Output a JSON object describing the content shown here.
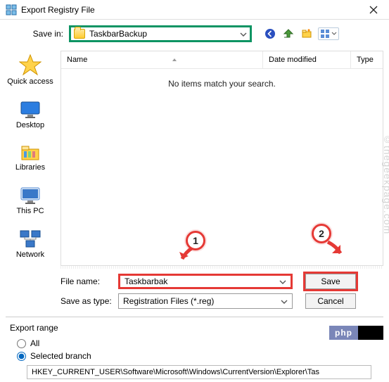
{
  "title": "Export Registry File",
  "savein": {
    "label": "Save in:",
    "value": "TaskbarBackup"
  },
  "places": {
    "quick_access": "Quick access",
    "desktop": "Desktop",
    "libraries": "Libraries",
    "this_pc": "This PC",
    "network": "Network"
  },
  "columns": {
    "name": "Name",
    "date": "Date modified",
    "type": "Type"
  },
  "empty_message": "No items match your search.",
  "filename": {
    "label": "File name:",
    "value": "Taskbarbak"
  },
  "savetype": {
    "label": "Save as type:",
    "value": "Registration Files (*.reg)"
  },
  "buttons": {
    "save": "Save",
    "cancel": "Cancel"
  },
  "export_range": {
    "header": "Export range",
    "all": "All",
    "selected": "Selected branch",
    "path": "HKEY_CURRENT_USER\\Software\\Microsoft\\Windows\\CurrentVersion\\Explorer\\Tas"
  },
  "annotations": {
    "one": "1",
    "two": "2"
  },
  "watermark": "©thegeekpage.com",
  "badge": {
    "php": "php"
  }
}
